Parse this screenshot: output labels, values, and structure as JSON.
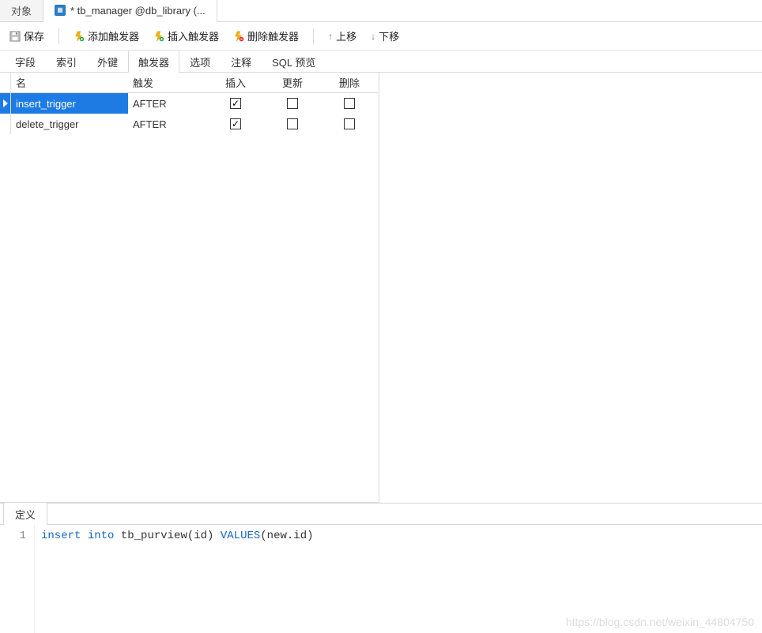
{
  "tabs_top": {
    "objects_label": "对象",
    "editor_label": "* tb_manager @db_library (..."
  },
  "toolbar": {
    "save": "保存",
    "add_trigger": "添加触发器",
    "insert_trigger": "插入触发器",
    "delete_trigger": "删除触发器",
    "move_up": "上移",
    "move_down": "下移"
  },
  "subtabs": {
    "fields": "字段",
    "indexes": "索引",
    "fks": "外键",
    "triggers": "触发器",
    "options": "选项",
    "comment": "注释",
    "sql_preview": "SQL 预览"
  },
  "grid": {
    "headers": {
      "name": "名",
      "fire": "触发",
      "insert": "插入",
      "update": "更新",
      "delete": "删除"
    },
    "rows": [
      {
        "name": "insert_trigger",
        "fire": "AFTER",
        "insert": true,
        "update": false,
        "delete": false,
        "selected": true
      },
      {
        "name": "delete_trigger",
        "fire": "AFTER",
        "insert": true,
        "update": false,
        "delete": false,
        "selected": false
      }
    ]
  },
  "bottom": {
    "definition_tab": "定义",
    "line_number": "1",
    "sql_parts": {
      "kw_insert": "insert",
      "kw_into": "into",
      "tbl": " tb_purview(id) ",
      "kw_values": "VALUES",
      "tail": "(new.id)"
    }
  },
  "watermark": "https://blog.csdn.net/weixin_44804750"
}
